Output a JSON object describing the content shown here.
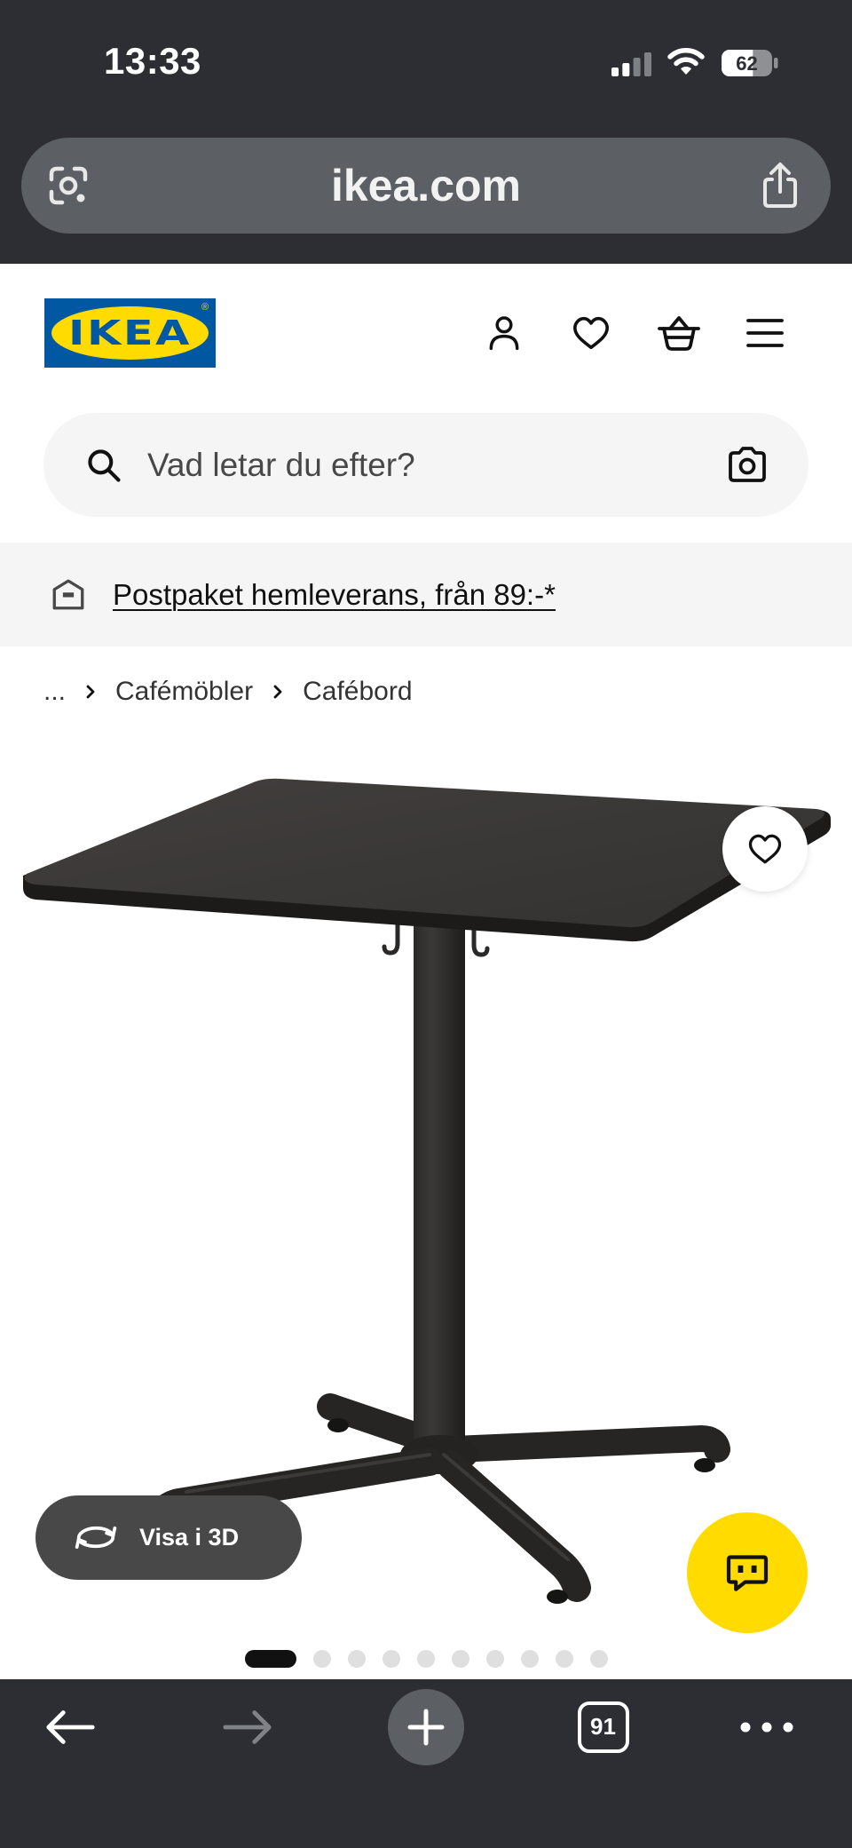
{
  "status_bar": {
    "time": "13:33",
    "battery": "62",
    "signal_total_bars": 4,
    "signal_active_bars": 2
  },
  "browser": {
    "url": "ikea.com",
    "tabs_count": "91",
    "forward_enabled": false
  },
  "header": {
    "logo_text": "IKEA",
    "logo_mark": "®"
  },
  "search": {
    "placeholder": "Vad letar du efter?"
  },
  "promo": {
    "text": "Postpaket hemleverans, från 89:-*"
  },
  "breadcrumb": {
    "items": [
      "...",
      "Cafémöbler",
      "Cafébord"
    ]
  },
  "product": {
    "view_3d_label": "Visa i 3D",
    "carousel": {
      "count": 10,
      "active": 0
    }
  },
  "icons": {
    "status": [
      "signal-icon",
      "wifi-icon",
      "battery-icon"
    ],
    "url_bar": [
      "lens-icon",
      "share-icon"
    ],
    "header": [
      "user-icon",
      "heart-icon",
      "basket-icon",
      "menu-icon"
    ],
    "search": [
      "search-icon",
      "camera-icon"
    ],
    "promo": "delivery-icon",
    "breadcrumb_separator": "chevron-right-icon",
    "product": [
      "heart-icon",
      "3d-rotate-icon",
      "chat-icon"
    ],
    "bottom_bar": [
      "back-arrow-icon",
      "forward-arrow-icon",
      "plus-icon",
      "tabs-icon",
      "more-icon"
    ]
  },
  "colors": {
    "browser_chrome": "#2c2e33",
    "url_bar": "#5c6065",
    "brand_blue": "#0058a3",
    "brand_yellow": "#ffdb00",
    "surface_gray": "#f5f5f5",
    "text_secondary": "#484848"
  }
}
